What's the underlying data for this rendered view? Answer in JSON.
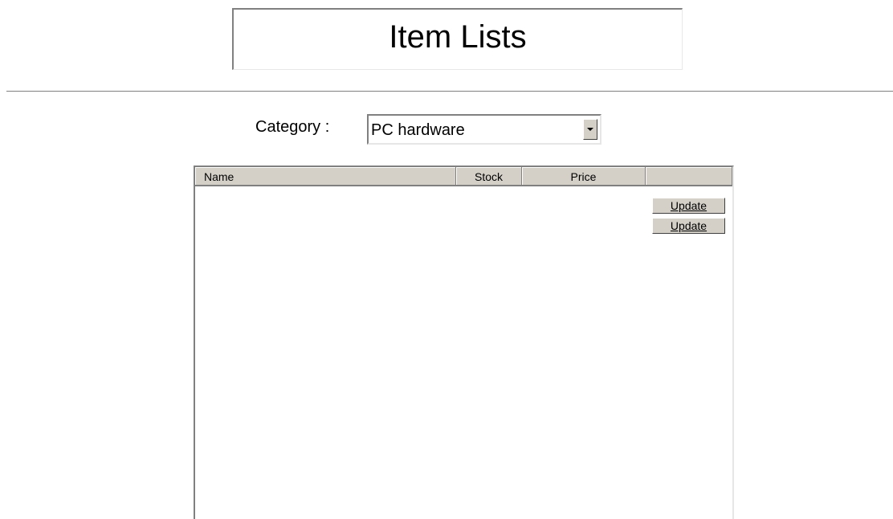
{
  "page": {
    "title": "Item Lists"
  },
  "category": {
    "label": "Category :",
    "selected": "PC hardware"
  },
  "list": {
    "columns": [
      "Name",
      "Stock",
      "Price",
      ""
    ],
    "rows": [
      {
        "action_label": "Update"
      },
      {
        "action_label": "Update"
      }
    ]
  },
  "icons": {
    "dropdown": "chevron-down-icon"
  }
}
